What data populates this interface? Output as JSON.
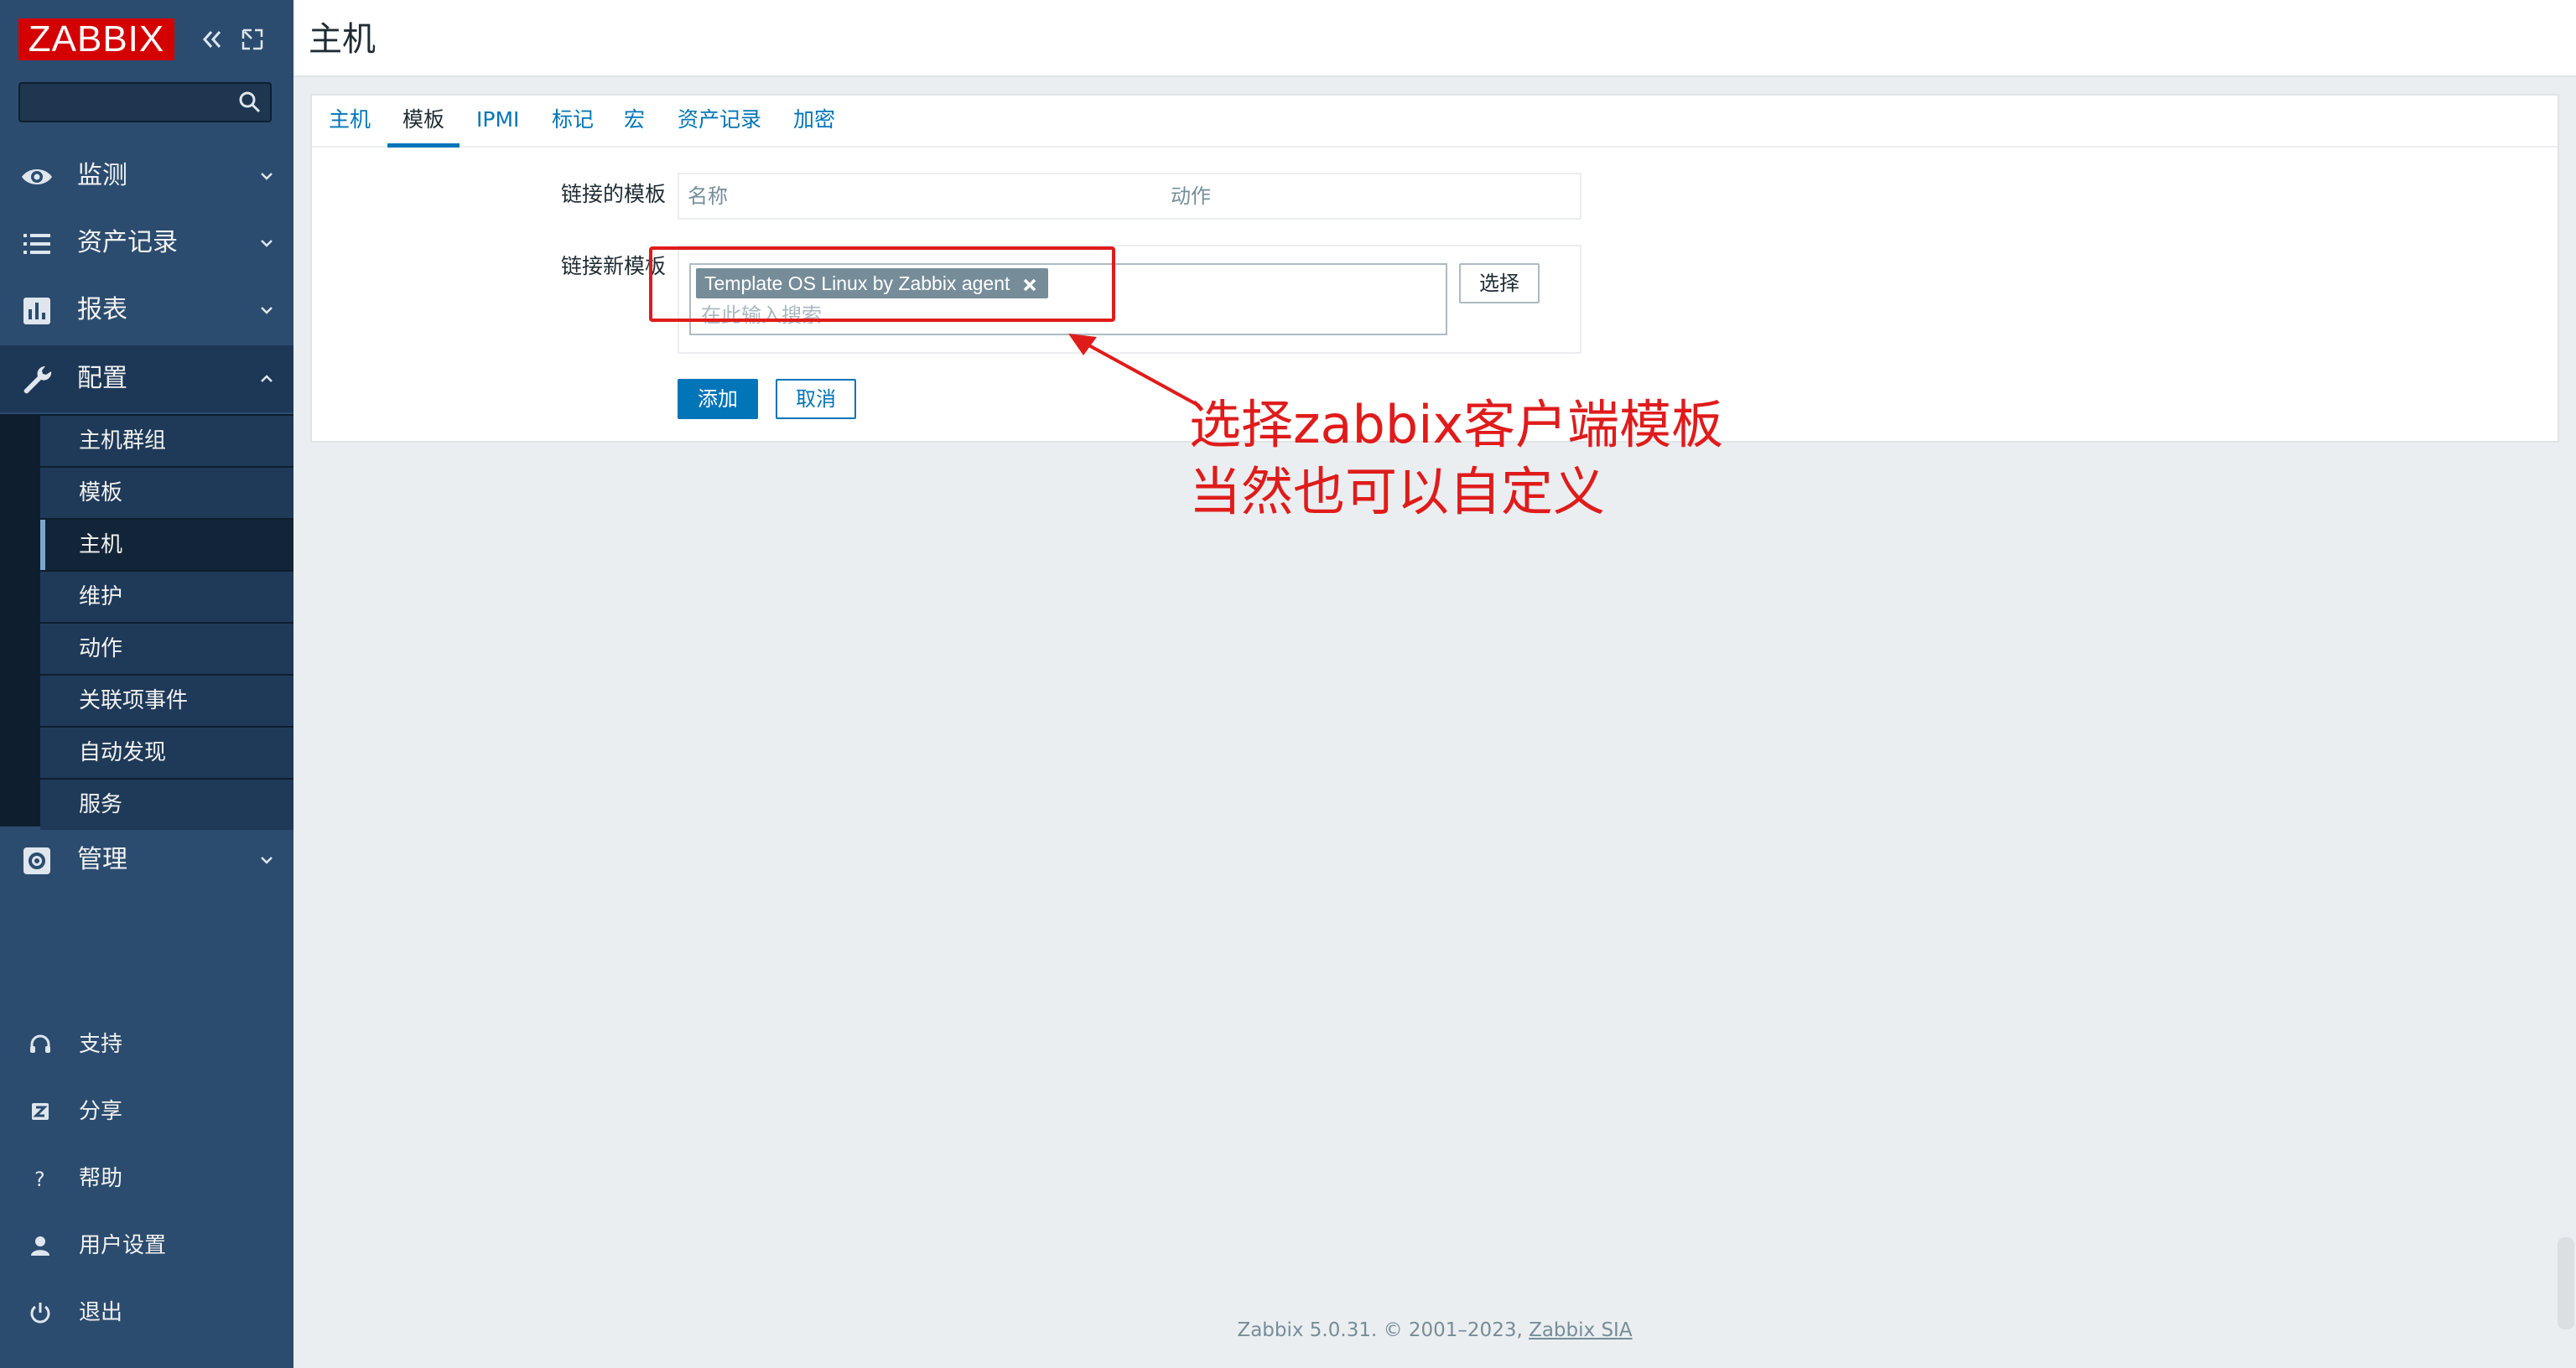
{
  "app": {
    "logo": "ZABBIX",
    "search": {
      "placeholder": ""
    }
  },
  "sidebar": {
    "menu": [
      {
        "label": "监测",
        "icon": "eye-icon"
      },
      {
        "label": "资产记录",
        "icon": "list-icon"
      },
      {
        "label": "报表",
        "icon": "bar-chart-icon"
      },
      {
        "label": "配置",
        "icon": "wrench-icon",
        "expanded": true
      },
      {
        "label": "管理",
        "icon": "gear-icon"
      }
    ],
    "config_submenu": [
      "主机群组",
      "模板",
      "主机",
      "维护",
      "动作",
      "关联项事件",
      "自动发现",
      "服务"
    ],
    "active_submenu": "主机",
    "bottom": [
      {
        "label": "支持",
        "icon": "headset-icon"
      },
      {
        "label": "分享",
        "icon": "share-icon"
      },
      {
        "label": "帮助",
        "icon": "help-icon"
      },
      {
        "label": "用户设置",
        "icon": "user-icon"
      },
      {
        "label": "退出",
        "icon": "power-icon"
      }
    ]
  },
  "header": {
    "title": "主机"
  },
  "tabs": [
    {
      "label": "主机"
    },
    {
      "label": "模板",
      "active": true
    },
    {
      "label": "IPMI"
    },
    {
      "label": "标记"
    },
    {
      "label": "宏"
    },
    {
      "label": "资产记录"
    },
    {
      "label": "加密"
    }
  ],
  "form": {
    "linked_templates_label": "链接的模板",
    "linked_table_headers": [
      "名称",
      "动作"
    ],
    "link_new_label": "链接新模板",
    "selected_template": "Template OS Linux by Zabbix agent",
    "search_placeholder": "在此输入搜索",
    "select_button": "选择",
    "add_button": "添加",
    "cancel_button": "取消"
  },
  "annotation": {
    "line1": "选择zabbix客户端模板",
    "line2": "当然也可以自定义",
    "color": "#e01b1b"
  },
  "footer": {
    "text": "Zabbix 5.0.31. © 2001–2023,",
    "link": "Zabbix SIA"
  },
  "colors": {
    "sidebar": "#2b4c6f",
    "accent": "#0275b8",
    "logo": "#d40000"
  }
}
